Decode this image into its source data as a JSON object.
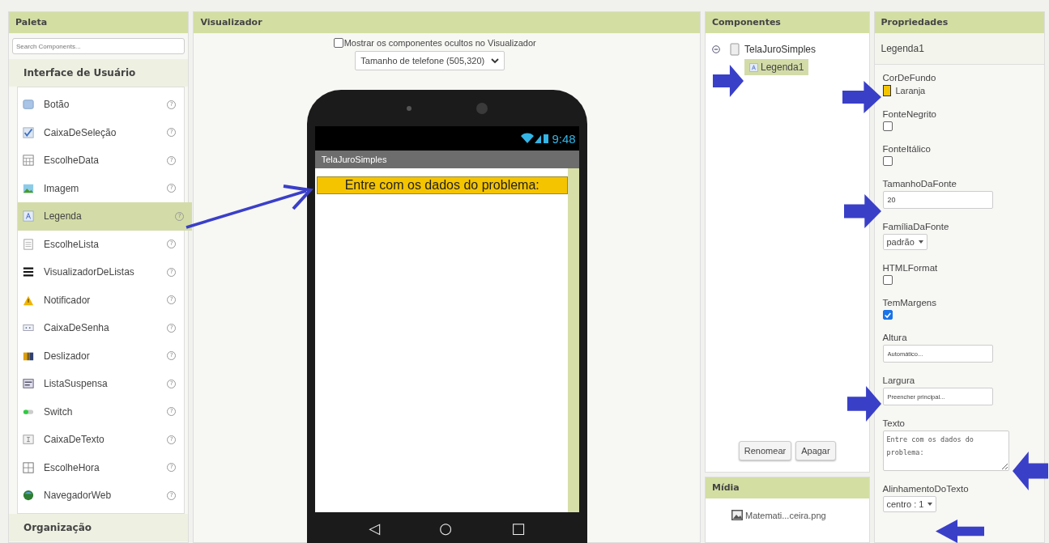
{
  "palette": {
    "title": "Paleta",
    "search": {
      "placeholder": "Search Components..."
    },
    "section": "Interface de Usuário",
    "items": [
      {
        "label": "Botão",
        "help": "?",
        "selected": false
      },
      {
        "label": "CaixaDeSeleção",
        "help": "?",
        "selected": false
      },
      {
        "label": "EscolheData",
        "help": "?",
        "selected": false
      },
      {
        "label": "Imagem",
        "help": "?",
        "selected": false
      },
      {
        "label": "Legenda",
        "help": "?",
        "selected": true
      },
      {
        "label": "EscolheLista",
        "help": "?",
        "selected": false
      },
      {
        "label": "VisualizadorDeListas",
        "help": "?",
        "selected": false
      },
      {
        "label": "Notificador",
        "help": "?",
        "selected": false
      },
      {
        "label": "CaixaDeSenha",
        "help": "?",
        "selected": false
      },
      {
        "label": "Deslizador",
        "help": "?",
        "selected": false
      },
      {
        "label": "ListaSuspensa",
        "help": "?",
        "selected": false
      },
      {
        "label": "Switch",
        "help": "?",
        "selected": false
      },
      {
        "label": "CaixaDeTexto",
        "help": "?",
        "selected": false
      },
      {
        "label": "EscolheHora",
        "help": "?",
        "selected": false
      },
      {
        "label": "NavegadorWeb",
        "help": "?",
        "selected": false
      }
    ],
    "next_section": "Organização"
  },
  "viewer": {
    "title": "Visualizador",
    "show_hidden": {
      "label": "Mostrar os componentes ocultos no Visualizador",
      "checked": false
    },
    "size_select": "Tamanho de telefone (505,320)",
    "phone": {
      "time": "9:48",
      "screen_title": "TelaJuroSimples",
      "label_text": "Entre com os dados do problema:",
      "nav": [
        "◁",
        "○",
        "□"
      ]
    }
  },
  "components": {
    "title": "Componentes",
    "tree": [
      {
        "label": "TelaJuroSimples",
        "expanded": true,
        "selected": false,
        "children": [
          {
            "label": "Legenda1",
            "selected": true
          }
        ]
      }
    ],
    "buttons": [
      "Renomear",
      "Apagar"
    ]
  },
  "media": {
    "title": "Mídia",
    "files": [
      "Matemati...ceira.png"
    ]
  },
  "properties": {
    "title": "Propriedades",
    "component": "Legenda1",
    "items": [
      {
        "kind": "color",
        "label": "CorDeFundo",
        "value": "Laranja",
        "color": "#f5c400"
      },
      {
        "kind": "checkbox",
        "label": "FonteNegrito",
        "checked": false
      },
      {
        "kind": "checkbox",
        "label": "FonteItálico",
        "checked": false
      },
      {
        "kind": "text",
        "label": "TamanhoDaFonte",
        "value": "20"
      },
      {
        "kind": "select",
        "label": "FamíliaDaFonte",
        "value": "padrão"
      },
      {
        "kind": "checkbox",
        "label": "HTMLFormat",
        "checked": false
      },
      {
        "kind": "checkbox",
        "label": "TemMargens",
        "checked": true
      },
      {
        "kind": "text",
        "label": "Altura",
        "value": "Automático..."
      },
      {
        "kind": "text",
        "label": "Largura",
        "value": "Preencher principal..."
      },
      {
        "kind": "textarea",
        "label": "Texto",
        "value": "Entre com os dados do problema:"
      },
      {
        "kind": "select",
        "label": "AlinhamentoDoTexto",
        "value": "centro : 1"
      }
    ]
  }
}
